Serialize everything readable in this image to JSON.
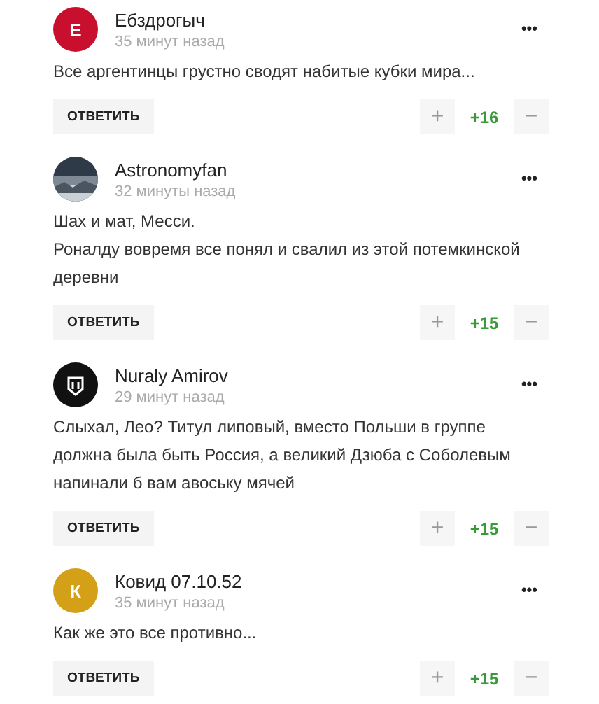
{
  "comments": [
    {
      "author": "Ебздрогыч",
      "time": "35 минут назад",
      "avatar": {
        "kind": "letter",
        "letter": "E",
        "color": "#c8102e"
      },
      "paragraphs": [
        "Все аргентинцы грустно сводят набитые кубки мира..."
      ],
      "reply": "ОТВЕТИТЬ",
      "plus": "+",
      "score": "+16",
      "minus": "−",
      "menu": "•••"
    },
    {
      "author": "Astronomyfan",
      "time": "32 минуты назад",
      "paragraphs": [
        "Шах и мат, Месси.",
        "Роналду вовремя все понял и свалил из этой потемкинской деревни"
      ],
      "reply": "ОТВЕТИТЬ",
      "plus": "+",
      "score": "+15",
      "minus": "−",
      "menu": "•••"
    },
    {
      "author": "Nuraly Amirov",
      "time": "29 минут назад",
      "avatar": {
        "kind": "logo"
      },
      "paragraphs": [
        "Слыхал, Лео? Титул липовый, вместо Польши в группе должна была быть Россия, а великий Дзюба с Соболевым напинали б вам авоську мячей"
      ],
      "reply": "ОТВЕТИТЬ",
      "plus": "+",
      "score": "+15",
      "minus": "−",
      "menu": "•••"
    },
    {
      "author": "Ковид 07.10.52",
      "time": "35 минут назад",
      "avatar": {
        "kind": "letter",
        "letter": "К",
        "color": "#d4a017"
      },
      "paragraphs": [
        "Как же это все противно..."
      ],
      "reply": "ОТВЕТИТЬ",
      "plus": "+",
      "score": "+15",
      "minus": "−",
      "menu": "•••"
    }
  ]
}
